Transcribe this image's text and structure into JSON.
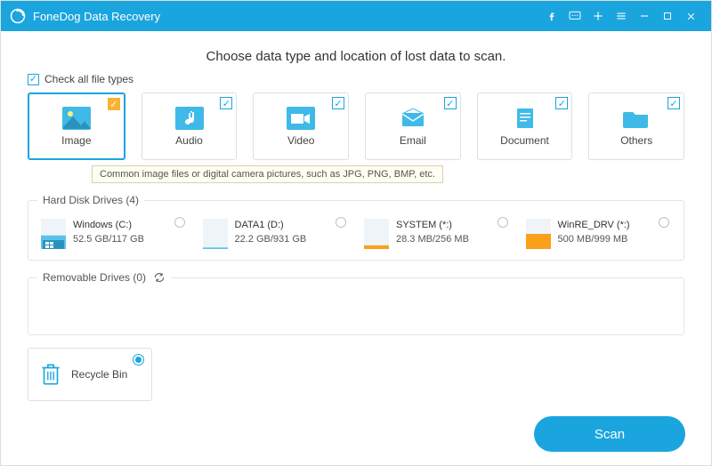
{
  "app": {
    "title": "FoneDog Data Recovery"
  },
  "heading": "Choose data type and location of lost data to scan.",
  "checkall_label": "Check all file types",
  "types": {
    "image": "Image",
    "audio": "Audio",
    "video": "Video",
    "email": "Email",
    "document": "Document",
    "others": "Others"
  },
  "tooltip": "Common image files or digital camera pictures, such as JPG, PNG, BMP, etc.",
  "sections": {
    "hdd": "Hard Disk Drives (4)",
    "removable": "Removable Drives (0)"
  },
  "drives": [
    {
      "name": "Windows (C:)",
      "stat": "52.5 GB/117 GB",
      "fill": 0.45,
      "color": "#59c2ec"
    },
    {
      "name": "DATA1 (D:)",
      "stat": "22.2 GB/931 GB",
      "fill": 0.05,
      "color": "#59c2ec"
    },
    {
      "name": "SYSTEM (*:)",
      "stat": "28.3 MB/256 MB",
      "fill": 0.12,
      "color": "#f9a11b"
    },
    {
      "name": "WinRE_DRV (*:)",
      "stat": "500 MB/999 MB",
      "fill": 0.5,
      "color": "#f9a11b"
    }
  ],
  "recycle_label": "Recycle Bin",
  "scan_label": "Scan"
}
